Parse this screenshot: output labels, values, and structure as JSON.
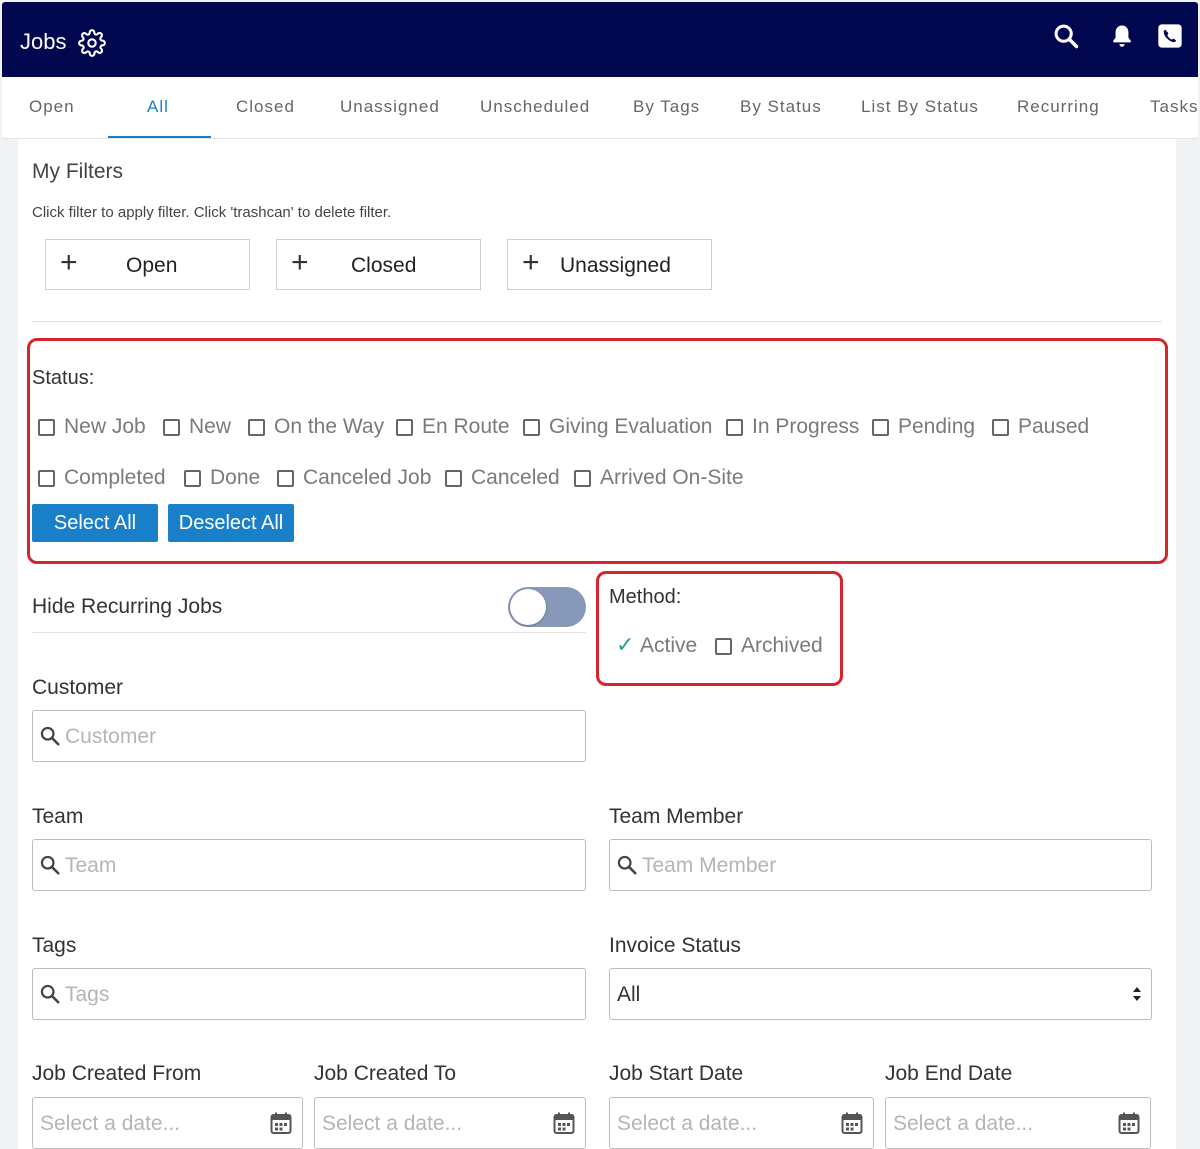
{
  "header": {
    "title": "Jobs"
  },
  "tabs": [
    "Open",
    "All",
    "Closed",
    "Unassigned",
    "Unscheduled",
    "By Tags",
    "By Status",
    "List By Status",
    "Recurring",
    "Tasks"
  ],
  "active_tab": "All",
  "my_filters": {
    "heading": "My Filters",
    "help": "Click filter to apply filter. Click 'trashcan' to delete filter.",
    "items": [
      "Open",
      "Closed",
      "Unassigned"
    ]
  },
  "status": {
    "label": "Status:",
    "options": [
      "New Job",
      "New",
      "On the Way",
      "En Route",
      "Giving Evaluation",
      "In Progress",
      "Pending",
      "Paused",
      "Completed",
      "Done",
      "Canceled Job",
      "Canceled",
      "Arrived On-Site"
    ],
    "select_all": "Select All",
    "deselect_all": "Deselect All"
  },
  "hide_recurring": {
    "label": "Hide Recurring Jobs",
    "on": false
  },
  "method": {
    "label": "Method:",
    "options": [
      {
        "label": "Active",
        "checked": true
      },
      {
        "label": "Archived",
        "checked": false
      }
    ]
  },
  "fields": {
    "customer": {
      "label": "Customer",
      "placeholder": "Customer"
    },
    "team": {
      "label": "Team",
      "placeholder": "Team"
    },
    "team_member": {
      "label": "Team Member",
      "placeholder": "Team Member"
    },
    "tags": {
      "label": "Tags",
      "placeholder": "Tags"
    },
    "invoice_status": {
      "label": "Invoice Status",
      "value": "All"
    },
    "job_created_from": {
      "label": "Job Created From",
      "placeholder": "Select a date..."
    },
    "job_created_to": {
      "label": "Job Created To",
      "placeholder": "Select a date..."
    },
    "job_start_date": {
      "label": "Job Start Date",
      "placeholder": "Select a date..."
    },
    "job_end_date": {
      "label": "Job End Date",
      "placeholder": "Select a date..."
    }
  },
  "colors": {
    "header_bg": "#020850",
    "accent": "#1a7fc9",
    "highlight": "#d6252b",
    "toggle_off": "#8898b8",
    "check": "#2aa198"
  }
}
